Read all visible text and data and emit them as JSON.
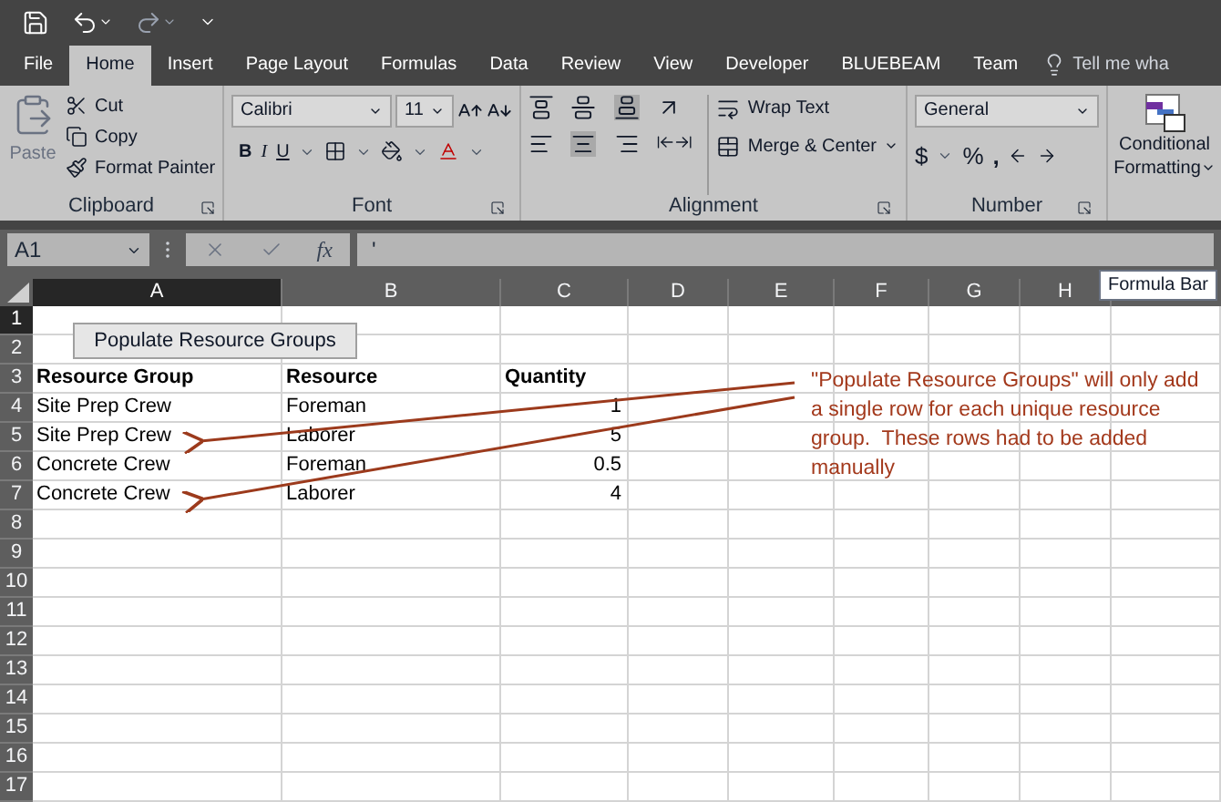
{
  "tabs": [
    {
      "label": "File",
      "selected": false
    },
    {
      "label": "Home",
      "selected": true
    },
    {
      "label": "Insert",
      "selected": false
    },
    {
      "label": "Page Layout",
      "selected": false
    },
    {
      "label": "Formulas",
      "selected": false
    },
    {
      "label": "Data",
      "selected": false
    },
    {
      "label": "Review",
      "selected": false
    },
    {
      "label": "View",
      "selected": false
    },
    {
      "label": "Developer",
      "selected": false
    },
    {
      "label": "BLUEBEAM",
      "selected": false
    },
    {
      "label": "Team",
      "selected": false
    }
  ],
  "tell_me": "Tell me wha",
  "ribbon": {
    "clipboard": {
      "paste": "Paste",
      "cut": "Cut",
      "copy": "Copy",
      "format_painter": "Format Painter",
      "label": "Clipboard"
    },
    "font": {
      "name": "Calibri",
      "size": "11",
      "bold": "B",
      "italic": "I",
      "underline": "U",
      "label": "Font"
    },
    "alignment": {
      "wrap": "Wrap Text",
      "merge": "Merge & Center",
      "label": "Alignment"
    },
    "number": {
      "format": "General",
      "currency": "$",
      "percent": "%",
      "comma": ",",
      "label": "Number"
    },
    "styles": {
      "conditional": "Conditional",
      "formatting": "Formatting"
    }
  },
  "formula_bar": {
    "name_box": "A1",
    "fx": "fx",
    "content": "'"
  },
  "tooltip": "Formula Bar",
  "columns": [
    {
      "label": "A",
      "selected": true
    },
    {
      "label": "B",
      "selected": false
    },
    {
      "label": "C",
      "selected": false
    },
    {
      "label": "D",
      "selected": false
    },
    {
      "label": "E",
      "selected": false
    },
    {
      "label": "F",
      "selected": false
    },
    {
      "label": "G",
      "selected": false
    },
    {
      "label": "H",
      "selected": false
    }
  ],
  "rows": [
    {
      "number": "1",
      "selected": true
    },
    {
      "number": "2",
      "selected": false
    },
    {
      "number": "3",
      "selected": false,
      "kind": "header",
      "cells": [
        "Resource Group",
        "Resource",
        "Quantity"
      ]
    },
    {
      "number": "4",
      "selected": false,
      "kind": "data",
      "cells": [
        "Site Prep Crew",
        "Foreman",
        "1"
      ]
    },
    {
      "number": "5",
      "selected": false,
      "kind": "data",
      "cells": [
        "Site Prep Crew",
        "Laborer",
        "5"
      ]
    },
    {
      "number": "6",
      "selected": false,
      "kind": "data",
      "cells": [
        "Concrete Crew",
        "Foreman",
        "0.5"
      ]
    },
    {
      "number": "7",
      "selected": false,
      "kind": "data",
      "cells": [
        "Concrete Crew",
        "Laborer",
        "4"
      ]
    },
    {
      "number": "8",
      "selected": false
    },
    {
      "number": "9",
      "selected": false
    },
    {
      "number": "10",
      "selected": false
    },
    {
      "number": "11",
      "selected": false
    },
    {
      "number": "12",
      "selected": false
    },
    {
      "number": "13",
      "selected": false
    },
    {
      "number": "14",
      "selected": false
    },
    {
      "number": "15",
      "selected": false
    },
    {
      "number": "16",
      "selected": false
    },
    {
      "number": "17",
      "selected": false
    }
  ],
  "sheet_button": "Populate Resource Groups",
  "annotation": "\"Populate Resource Groups\" will only add a single row for each unique resource group.  These rows had to be added manually"
}
